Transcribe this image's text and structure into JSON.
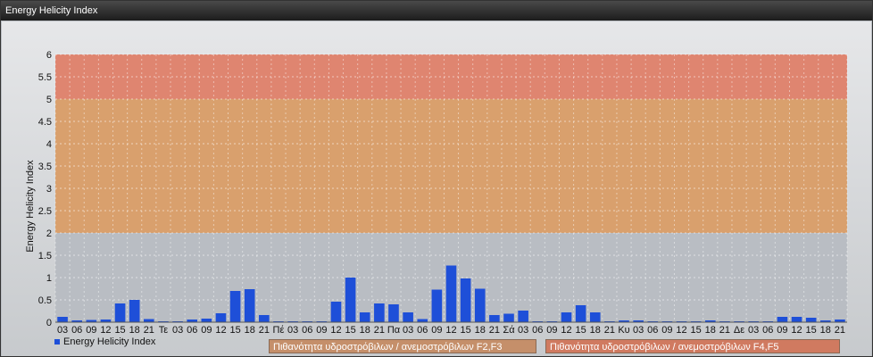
{
  "window": {
    "title": "Energy Helicity Index"
  },
  "legend": {
    "series_label": "Energy Helicity Index"
  },
  "probability_labels": [
    {
      "text": "Πιθανότητα υδροστρόβιλων / ανεμοστρόβιλων F2,F3",
      "color": "#c58f6a"
    },
    {
      "text": "Πιθανότητα υδροστρόβιλων / ανεμοστρόβιλων F4,F5",
      "color": "#d07a60"
    }
  ],
  "chart_data": {
    "type": "bar",
    "ylabel": "Energy Helicity Index",
    "ylim": [
      0,
      6
    ],
    "yticks": [
      "0",
      "0.5",
      "1",
      "1.5",
      "2",
      "2.5",
      "3",
      "3.5",
      "4",
      "4.5",
      "5",
      "5.5",
      "6"
    ],
    "bands": [
      {
        "from": 0,
        "to": 2,
        "color": "#b9bdc3"
      },
      {
        "from": 2,
        "to": 5,
        "color": "#d9a06d"
      },
      {
        "from": 5,
        "to": 6,
        "color": "#df8570"
      }
    ],
    "categories": [
      "03",
      "06",
      "09",
      "12",
      "15",
      "18",
      "21",
      "Τε",
      "03",
      "06",
      "09",
      "12",
      "15",
      "18",
      "21",
      "Πέ",
      "03",
      "06",
      "09",
      "12",
      "15",
      "18",
      "21",
      "Πα",
      "03",
      "06",
      "09",
      "12",
      "15",
      "18",
      "21",
      "Σά",
      "03",
      "06",
      "09",
      "12",
      "15",
      "18",
      "21",
      "Κυ",
      "03",
      "06",
      "09",
      "12",
      "15",
      "18",
      "21",
      "Δε",
      "03",
      "06",
      "09",
      "12",
      "15",
      "18",
      "21"
    ],
    "series": [
      {
        "name": "Energy Helicity Index",
        "color": "#1e4fd8",
        "values": [
          0.12,
          0.04,
          0.05,
          0.06,
          0.42,
          0.5,
          0.07,
          0.02,
          0.02,
          0.06,
          0.08,
          0.2,
          0.7,
          0.74,
          0.16,
          0.02,
          0.02,
          0.02,
          0.02,
          0.46,
          1.0,
          0.22,
          0.42,
          0.4,
          0.22,
          0.07,
          0.73,
          1.27,
          0.98,
          0.75,
          0.16,
          0.19,
          0.26,
          0.02,
          0.02,
          0.22,
          0.38,
          0.22,
          0.02,
          0.04,
          0.04,
          0.02,
          0.02,
          0.02,
          0.02,
          0.04,
          0.02,
          0.02,
          0.02,
          0.02,
          0.12,
          0.12,
          0.1,
          0.04,
          0.06
        ]
      }
    ]
  }
}
